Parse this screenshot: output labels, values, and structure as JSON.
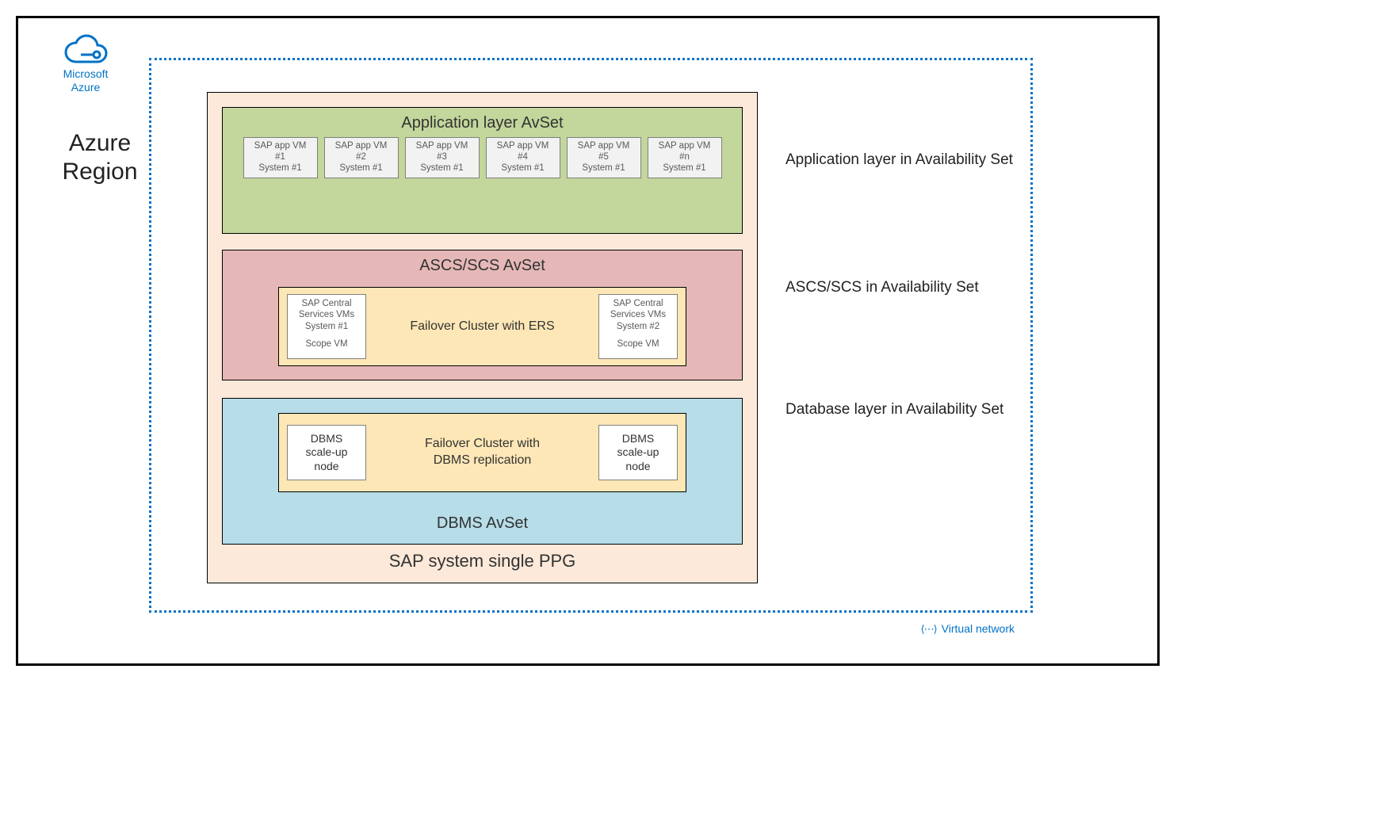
{
  "logo": {
    "line1": "Microsoft",
    "line2": "Azure"
  },
  "region_label_l1": "Azure",
  "region_label_l2": "Region",
  "vnet_label": "Virtual network",
  "ppg_label": "SAP system single PPG",
  "app_avset": {
    "title": "Application layer AvSet",
    "side_label": "Application layer in Availability Set",
    "vms": [
      {
        "l1": "SAP app VM",
        "l2": "#1",
        "l3": "System #1"
      },
      {
        "l1": "SAP app VM",
        "l2": "#2",
        "l3": "System #1"
      },
      {
        "l1": "SAP app VM",
        "l2": "#3",
        "l3": "System #1"
      },
      {
        "l1": "SAP app VM",
        "l2": "#4",
        "l3": "System #1"
      },
      {
        "l1": "SAP app VM",
        "l2": "#5",
        "l3": "System #1"
      },
      {
        "l1": "SAP app VM",
        "l2": "#n",
        "l3": "System #1"
      }
    ]
  },
  "ascs_avset": {
    "title": "ASCS/SCS AvSet",
    "side_label": "ASCS/SCS in Availability Set",
    "failover_label": "Failover Cluster with ERS",
    "vm_left": {
      "l1": "SAP Central",
      "l2": "Services VMs",
      "l3": "System #1",
      "scope": "Scope VM"
    },
    "vm_right": {
      "l1": "SAP Central",
      "l2": "Services VMs",
      "l3": "System #2",
      "scope": "Scope VM"
    }
  },
  "dbms_avset": {
    "title": "DBMS AvSet",
    "side_label": "Database layer in Availability Set",
    "failover_l1": "Failover Cluster with",
    "failover_l2": "DBMS replication",
    "vm_left": {
      "l1": "DBMS",
      "l2": "scale-up",
      "l3": "node"
    },
    "vm_right": {
      "l1": "DBMS",
      "l2": "scale-up",
      "l3": "node"
    }
  }
}
